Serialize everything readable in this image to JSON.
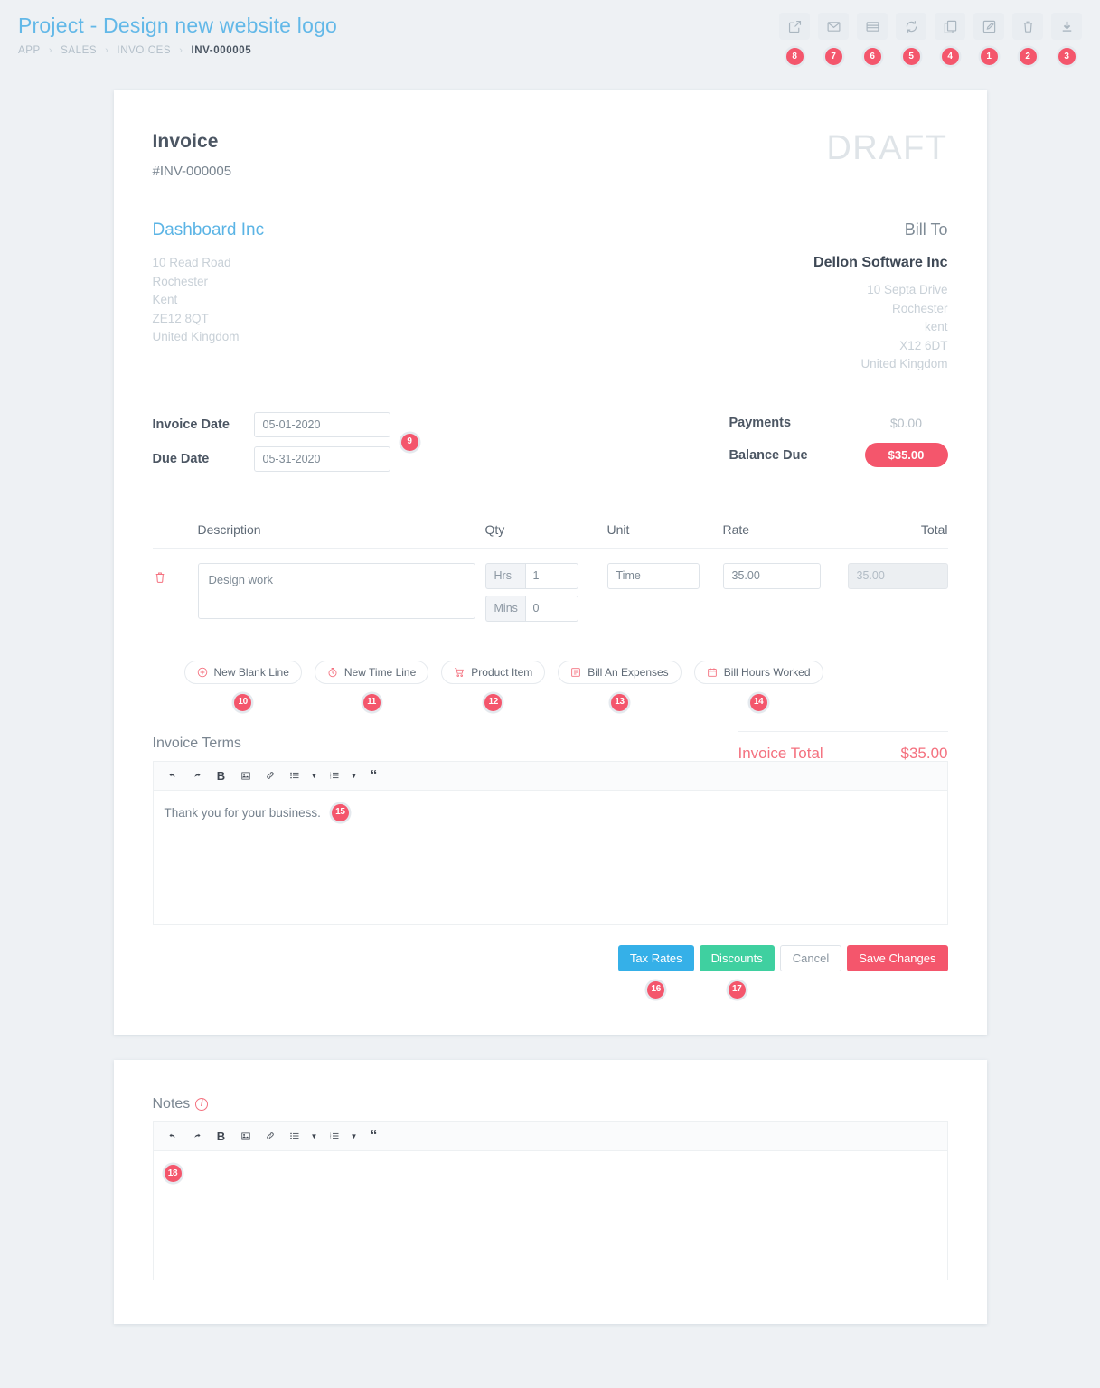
{
  "header": {
    "title": "Project - Design new website logo",
    "breadcrumb": [
      "APP",
      "SALES",
      "INVOICES",
      "INV-000005"
    ],
    "separator": "›"
  },
  "toolbar": [
    {
      "icon": "share-icon",
      "marker": "8",
      "label": "Share"
    },
    {
      "icon": "envelope-icon",
      "marker": "7",
      "label": "Email"
    },
    {
      "icon": "credit-card-icon",
      "marker": "6",
      "label": "Payment"
    },
    {
      "icon": "refresh-icon",
      "marker": "5",
      "label": "Recurring"
    },
    {
      "icon": "copy-icon",
      "marker": "4",
      "label": "Duplicate"
    },
    {
      "icon": "edit-icon",
      "marker": "1",
      "label": "Edit"
    },
    {
      "icon": "trash-icon",
      "marker": "2",
      "label": "Delete"
    },
    {
      "icon": "download-icon",
      "marker": "3",
      "label": "Download"
    }
  ],
  "invoice": {
    "title": "Invoice",
    "number": "#INV-000005",
    "status_watermark": "DRAFT",
    "from": {
      "name": "Dashboard Inc",
      "address": [
        "10 Read Road",
        "Rochester",
        "Kent",
        "ZE12 8QT",
        "United Kingdom"
      ]
    },
    "bill_to": {
      "label": "Bill To",
      "name": "Dellon Software Inc",
      "address": [
        "10 Septa Drive",
        "Rochester",
        "kent",
        "X12 6DT",
        "United Kingdom"
      ]
    },
    "dates": {
      "invoice_date_label": "Invoice Date",
      "invoice_date_value": "05-01-2020",
      "due_date_label": "Due Date",
      "due_date_value": "05-31-2020",
      "marker": "9"
    },
    "payments": {
      "payments_label": "Payments",
      "payments_value": "$0.00",
      "balance_label": "Balance Due",
      "balance_value": "$35.00"
    },
    "table": {
      "columns": [
        "Description",
        "Qty",
        "Unit",
        "Rate",
        "Total"
      ],
      "rows": [
        {
          "description": "Design work",
          "hrs_label": "Hrs",
          "hrs_value": "1",
          "mins_label": "Mins",
          "mins_value": "0",
          "unit": "Time",
          "rate": "35.00",
          "total": "35.00"
        }
      ]
    },
    "add_buttons": [
      {
        "label": "New Blank Line",
        "icon": "plus-circle-icon",
        "marker": "10"
      },
      {
        "label": "New Time Line",
        "icon": "stopwatch-icon",
        "marker": "11"
      },
      {
        "label": "Product Item",
        "icon": "cart-icon",
        "marker": "12"
      },
      {
        "label": "Bill An Expenses",
        "icon": "receipt-icon",
        "marker": "13"
      },
      {
        "label": "Bill Hours Worked",
        "icon": "calendar-icon",
        "marker": "14"
      }
    ],
    "totals": {
      "label": "Invoice Total",
      "value": "$35.00"
    },
    "terms": {
      "label": "Invoice Terms",
      "content": "Thank you for your business.",
      "marker": "15"
    },
    "footer_buttons": [
      {
        "label": "Tax Rates",
        "style": "blue",
        "marker": "16"
      },
      {
        "label": "Discounts",
        "style": "green",
        "marker": "17"
      },
      {
        "label": "Cancel",
        "style": "white",
        "marker": ""
      },
      {
        "label": "Save Changes",
        "style": "red",
        "marker": ""
      }
    ]
  },
  "notes": {
    "label": "Notes",
    "info_icon": "info-icon",
    "content": "",
    "marker": "18"
  },
  "editor_toolbar": [
    {
      "name": "undo-icon",
      "glyph": "↶"
    },
    {
      "name": "redo-icon",
      "glyph": "↷"
    },
    {
      "name": "bold-icon",
      "glyph": "B"
    },
    {
      "name": "image-icon",
      "glyph": "▣"
    },
    {
      "name": "link-icon",
      "glyph": "ὑ7"
    },
    {
      "name": "bullet-list-icon",
      "glyph": "≣"
    },
    {
      "name": "numbered-list-icon",
      "glyph": "≣"
    },
    {
      "name": "quote-icon",
      "glyph": "“"
    }
  ],
  "colors": {
    "accent_blue": "#5bb4e5",
    "danger_red": "#f4566c",
    "success_green": "#3fd0a0",
    "info_blue": "#35b0e8",
    "page_bg": "#eef1f4"
  }
}
